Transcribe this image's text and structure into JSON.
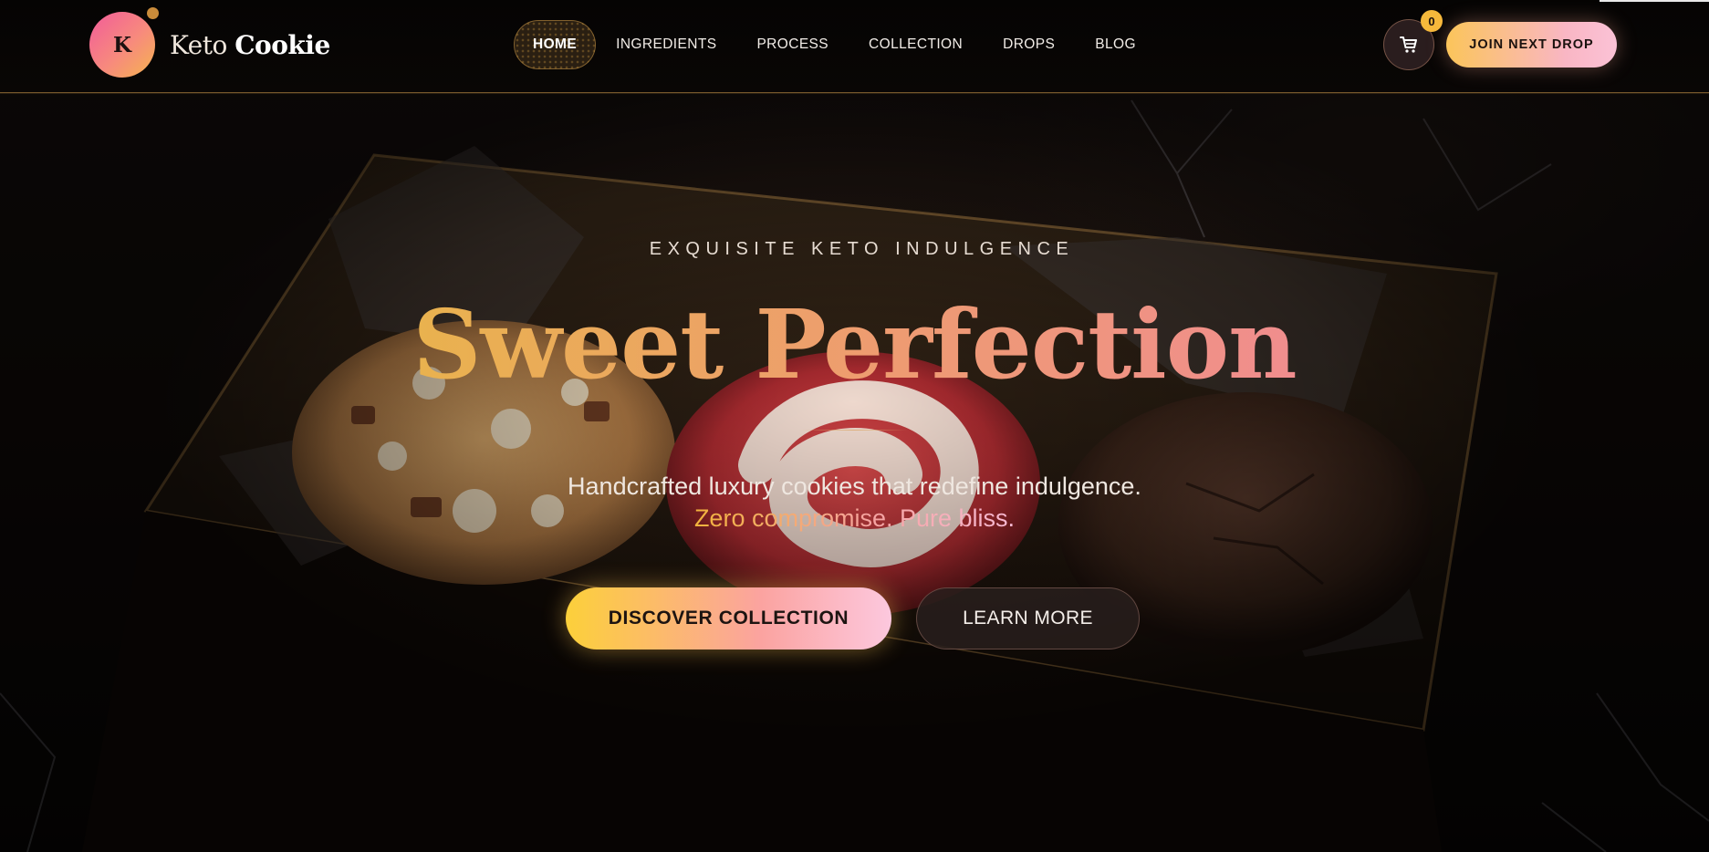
{
  "brand": {
    "initial": "K",
    "name_light": "Keto",
    "name_bold": "Cookie"
  },
  "nav": {
    "items": [
      {
        "label": "HOME",
        "active": true
      },
      {
        "label": "INGREDIENTS",
        "active": false
      },
      {
        "label": "PROCESS",
        "active": false
      },
      {
        "label": "COLLECTION",
        "active": false
      },
      {
        "label": "DROPS",
        "active": false
      },
      {
        "label": "BLOG",
        "active": false
      }
    ]
  },
  "cart": {
    "icon": "shopping-cart-icon",
    "count": "0"
  },
  "join_button": {
    "label": "JOIN NEXT DROP"
  },
  "hero": {
    "eyebrow": "EXQUISITE KETO INDULGENCE",
    "headline": "Sweet Perfection",
    "subtitle": "Handcrafted luxury cookies that redefine indulgence.",
    "subtitle_accent": "Zero compromise. Pure bliss.",
    "primary_cta": "DISCOVER COLLECTION",
    "secondary_cta": "LEARN MORE"
  },
  "colors": {
    "accent_gold": "#f6b93b",
    "accent_pink": "#f9b6c4",
    "header_border": "#d6a04e",
    "background": "#0a0706"
  }
}
